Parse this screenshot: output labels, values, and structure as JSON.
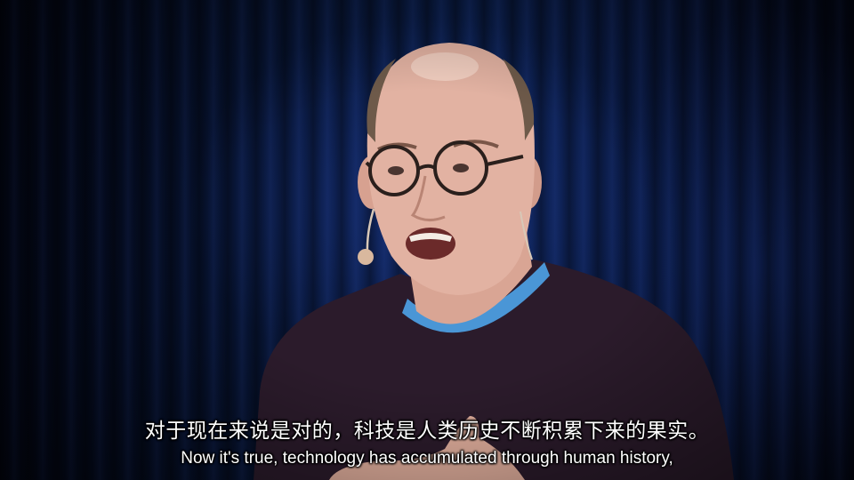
{
  "video": {
    "subtitles": {
      "chinese": "对于现在来说是对的，科技是人类历史不断积累下来的果实。",
      "english": "Now it's true, technology has accumulated through human history,"
    }
  },
  "colors": {
    "curtain": "#0b1f4d",
    "sweater": "#2a1a2a",
    "undershirt": "#3f8fd0",
    "subtitle_text": "#ffffff"
  }
}
